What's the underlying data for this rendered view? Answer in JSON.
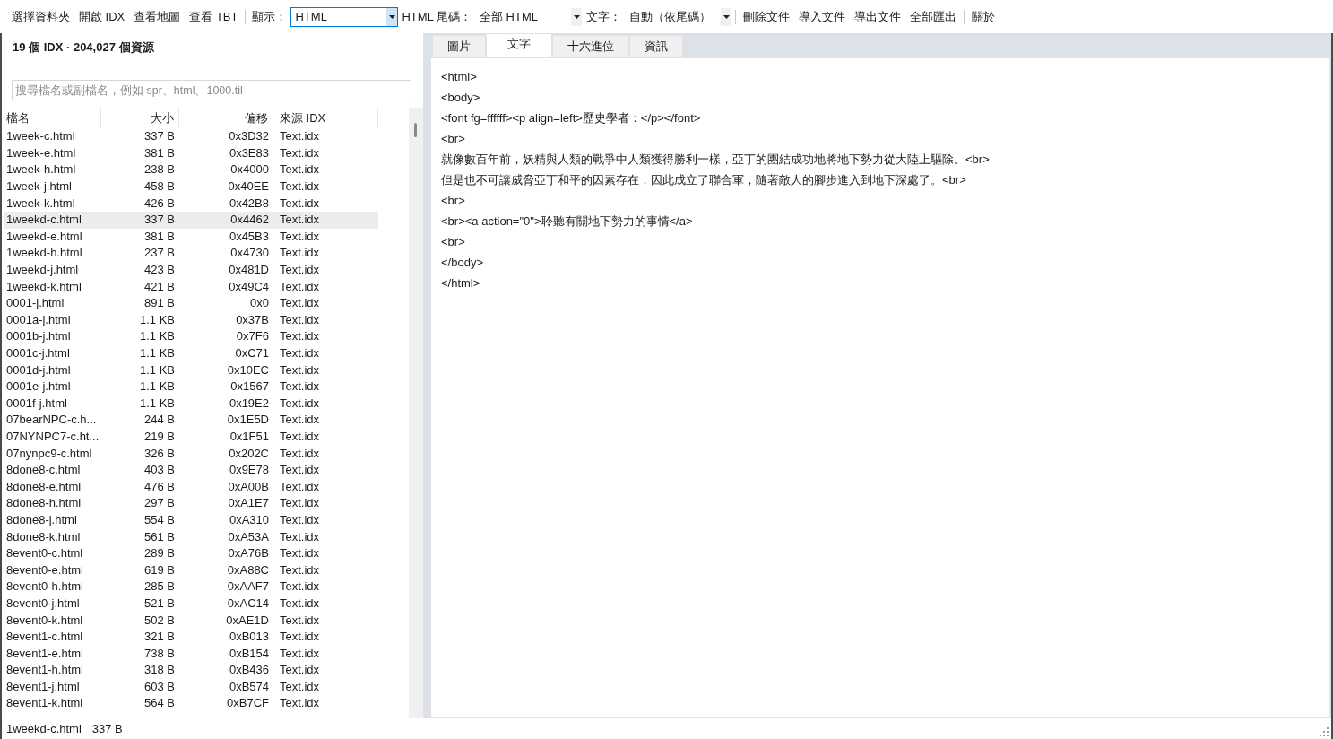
{
  "toolbar": {
    "items": [
      {
        "kind": "button",
        "label": "選擇資料夾"
      },
      {
        "kind": "button",
        "label": "開啟 IDX"
      },
      {
        "kind": "button",
        "label": "查看地圖"
      },
      {
        "kind": "button",
        "label": "查看 TBT"
      },
      {
        "kind": "separator"
      },
      {
        "kind": "select",
        "label": "顯示：",
        "value": "HTML",
        "focused": true
      },
      {
        "kind": "select",
        "label": "HTML 尾碼：",
        "value": "全部 HTML",
        "focused": false
      },
      {
        "kind": "select",
        "label": "文字：",
        "value": "自動（依尾碼）",
        "focused": false
      },
      {
        "kind": "separator"
      },
      {
        "kind": "button",
        "label": "刪除文件"
      },
      {
        "kind": "button",
        "label": "導入文件"
      },
      {
        "kind": "button",
        "label": "導出文件"
      },
      {
        "kind": "button",
        "label": "全部匯出"
      },
      {
        "kind": "separator"
      },
      {
        "kind": "button",
        "label": "關於"
      }
    ]
  },
  "resource_panel": {
    "summary": "19 個 IDX · 204,027 個資源",
    "search": {
      "placeholder": "搜尋檔名或副檔名，例如 spr、html、1000.til"
    },
    "table": {
      "columns": [
        "檔名",
        "大小",
        "偏移",
        "來源 IDX"
      ],
      "rows": [
        {
          "file_name": "1week-c.html",
          "size": "337 B",
          "offset": "0x3D32",
          "source_idx": "Text.idx",
          "selected": false
        },
        {
          "file_name": "1week-e.html",
          "size": "381 B",
          "offset": "0x3E83",
          "source_idx": "Text.idx",
          "selected": false
        },
        {
          "file_name": "1week-h.html",
          "size": "238 B",
          "offset": "0x4000",
          "source_idx": "Text.idx",
          "selected": false
        },
        {
          "file_name": "1week-j.html",
          "size": "458 B",
          "offset": "0x40EE",
          "source_idx": "Text.idx",
          "selected": false
        },
        {
          "file_name": "1week-k.html",
          "size": "426 B",
          "offset": "0x42B8",
          "source_idx": "Text.idx",
          "selected": false
        },
        {
          "file_name": "1weekd-c.html",
          "size": "337 B",
          "offset": "0x4462",
          "source_idx": "Text.idx",
          "selected": true
        },
        {
          "file_name": "1weekd-e.html",
          "size": "381 B",
          "offset": "0x45B3",
          "source_idx": "Text.idx",
          "selected": false
        },
        {
          "file_name": "1weekd-h.html",
          "size": "237 B",
          "offset": "0x4730",
          "source_idx": "Text.idx",
          "selected": false
        },
        {
          "file_name": "1weekd-j.html",
          "size": "423 B",
          "offset": "0x481D",
          "source_idx": "Text.idx",
          "selected": false
        },
        {
          "file_name": "1weekd-k.html",
          "size": "421 B",
          "offset": "0x49C4",
          "source_idx": "Text.idx",
          "selected": false
        },
        {
          "file_name": "0001-j.html",
          "size": "891 B",
          "offset": "0x0",
          "source_idx": "Text.idx",
          "selected": false
        },
        {
          "file_name": "0001a-j.html",
          "size": "1.1 KB",
          "offset": "0x37B",
          "source_idx": "Text.idx",
          "selected": false
        },
        {
          "file_name": "0001b-j.html",
          "size": "1.1 KB",
          "offset": "0x7F6",
          "source_idx": "Text.idx",
          "selected": false
        },
        {
          "file_name": "0001c-j.html",
          "size": "1.1 KB",
          "offset": "0xC71",
          "source_idx": "Text.idx",
          "selected": false
        },
        {
          "file_name": "0001d-j.html",
          "size": "1.1 KB",
          "offset": "0x10EC",
          "source_idx": "Text.idx",
          "selected": false
        },
        {
          "file_name": "0001e-j.html",
          "size": "1.1 KB",
          "offset": "0x1567",
          "source_idx": "Text.idx",
          "selected": false
        },
        {
          "file_name": "0001f-j.html",
          "size": "1.1 KB",
          "offset": "0x19E2",
          "source_idx": "Text.idx",
          "selected": false
        },
        {
          "file_name": "07bearNPC-c.h...",
          "size": "244 B",
          "offset": "0x1E5D",
          "source_idx": "Text.idx",
          "selected": false
        },
        {
          "file_name": "07NYNPC7-c.ht...",
          "size": "219 B",
          "offset": "0x1F51",
          "source_idx": "Text.idx",
          "selected": false
        },
        {
          "file_name": "07nynpc9-c.html",
          "size": "326 B",
          "offset": "0x202C",
          "source_idx": "Text.idx",
          "selected": false
        },
        {
          "file_name": "8done8-c.html",
          "size": "403 B",
          "offset": "0x9E78",
          "source_idx": "Text.idx",
          "selected": false
        },
        {
          "file_name": "8done8-e.html",
          "size": "476 B",
          "offset": "0xA00B",
          "source_idx": "Text.idx",
          "selected": false
        },
        {
          "file_name": "8done8-h.html",
          "size": "297 B",
          "offset": "0xA1E7",
          "source_idx": "Text.idx",
          "selected": false
        },
        {
          "file_name": "8done8-j.html",
          "size": "554 B",
          "offset": "0xA310",
          "source_idx": "Text.idx",
          "selected": false
        },
        {
          "file_name": "8done8-k.html",
          "size": "561 B",
          "offset": "0xA53A",
          "source_idx": "Text.idx",
          "selected": false
        },
        {
          "file_name": "8event0-c.html",
          "size": "289 B",
          "offset": "0xA76B",
          "source_idx": "Text.idx",
          "selected": false
        },
        {
          "file_name": "8event0-e.html",
          "size": "619 B",
          "offset": "0xA88C",
          "source_idx": "Text.idx",
          "selected": false
        },
        {
          "file_name": "8event0-h.html",
          "size": "285 B",
          "offset": "0xAAF7",
          "source_idx": "Text.idx",
          "selected": false
        },
        {
          "file_name": "8event0-j.html",
          "size": "521 B",
          "offset": "0xAC14",
          "source_idx": "Text.idx",
          "selected": false
        },
        {
          "file_name": "8event0-k.html",
          "size": "502 B",
          "offset": "0xAE1D",
          "source_idx": "Text.idx",
          "selected": false
        },
        {
          "file_name": "8event1-c.html",
          "size": "321 B",
          "offset": "0xB013",
          "source_idx": "Text.idx",
          "selected": false
        },
        {
          "file_name": "8event1-e.html",
          "size": "738 B",
          "offset": "0xB154",
          "source_idx": "Text.idx",
          "selected": false
        },
        {
          "file_name": "8event1-h.html",
          "size": "318 B",
          "offset": "0xB436",
          "source_idx": "Text.idx",
          "selected": false
        },
        {
          "file_name": "8event1-j.html",
          "size": "603 B",
          "offset": "0xB574",
          "source_idx": "Text.idx",
          "selected": false
        },
        {
          "file_name": "8event1-k.html",
          "size": "564 B",
          "offset": "0xB7CF",
          "source_idx": "Text.idx",
          "selected": false
        }
      ]
    }
  },
  "preview": {
    "tabs": [
      {
        "label": "圖片",
        "selected": false
      },
      {
        "label": "文字",
        "selected": true
      },
      {
        "label": "十六進位",
        "selected": false
      },
      {
        "label": "資訊",
        "selected": false
      }
    ],
    "lines": [
      "<html>",
      "<body>",
      "<font fg=ffffff><p align=left>歷史學者：</p></font>",
      "<br>",
      "就像數百年前，妖精與人類的戰爭中人類獲得勝利一樣，亞丁的團結成功地將地下勢力從大陸上驅除。<br>",
      "但是也不可讓威脅亞丁和平的因素存在，因此成立了聯合軍，隨著敵人的腳步進入到地下深處了。<br>",
      "<br>",
      "<br><a action=\"0\">聆聽有關地下勢力的事情</a>",
      "<br>",
      "</body>",
      "</html>"
    ]
  },
  "status_bar": {
    "file_name": "1weekd-c.html",
    "size": "337 B"
  }
}
